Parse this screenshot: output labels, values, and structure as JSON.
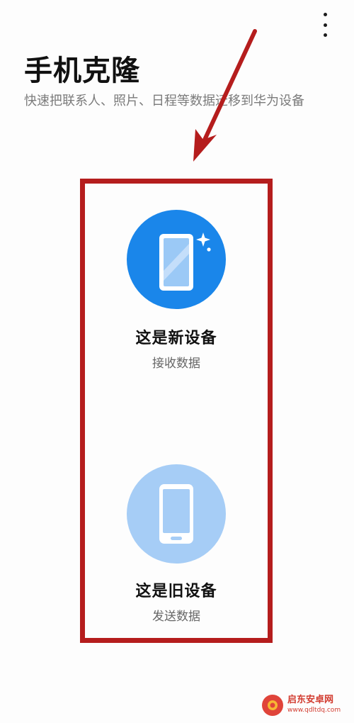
{
  "header": {
    "title": "手机克隆",
    "subtitle": "快速把联系人、照片、日程等数据迁移到华为设备",
    "menu_icon": "more-vertical-icon"
  },
  "options": {
    "new_device": {
      "title": "这是新设备",
      "description": "接收数据",
      "icon": "new-phone-sparkle-icon",
      "color": "#1a86ea"
    },
    "old_device": {
      "title": "这是旧设备",
      "description": "发送数据",
      "icon": "old-phone-icon",
      "color": "#a6cdf6"
    }
  },
  "annotation": {
    "color": "#b51d1d"
  },
  "watermark": {
    "text": "启东安卓网",
    "url": "www.qdltdq.com"
  }
}
